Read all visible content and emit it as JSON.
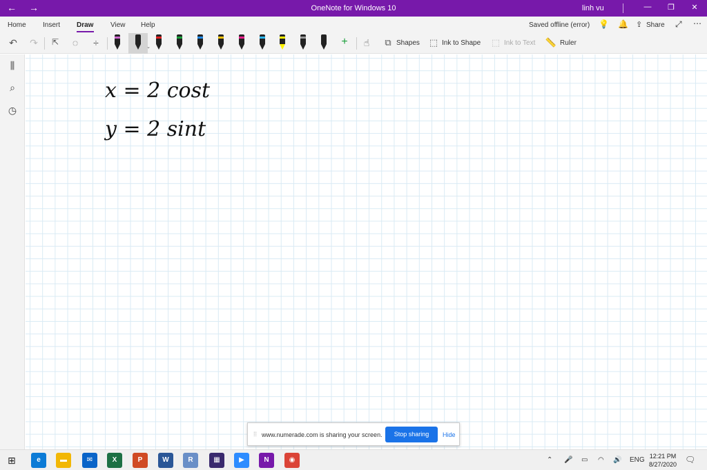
{
  "titlebar": {
    "back_icon": "back-arrow-icon",
    "forward_icon": "forward-arrow-icon",
    "title": "OneNote for Windows 10",
    "user": "linh vu",
    "minimize": "—",
    "restore": "❐",
    "close": "✕"
  },
  "menubar": {
    "tabs": [
      {
        "label": "Home"
      },
      {
        "label": "Insert"
      },
      {
        "label": "Draw",
        "active": true
      },
      {
        "label": "View"
      },
      {
        "label": "Help"
      }
    ],
    "status": "Saved offline (error)",
    "share": "Share"
  },
  "toolbar": {
    "shapes": "Shapes",
    "ink_to_shape": "Ink to Shape",
    "ink_to_text": "Ink to Text",
    "ruler": "Ruler",
    "pens": [
      {
        "color": "#222222",
        "band": "#cc66cc"
      },
      {
        "color": "#222222",
        "band": "#222222"
      },
      {
        "color": "#222222",
        "band": "#e02020"
      },
      {
        "color": "#222222",
        "band": "#1a9e3a"
      },
      {
        "color": "#222222",
        "band": "#1e88e5"
      },
      {
        "color": "#222222",
        "band": "#f4c20d"
      },
      {
        "color": "#222222",
        "band": "#e91e8c"
      },
      {
        "color": "#222222",
        "band": "#29b6f6"
      },
      {
        "color": "#222222",
        "band": "#fff200"
      },
      {
        "color": "#222222",
        "band": "#999999"
      },
      {
        "color": "#222222",
        "band": "#222222"
      }
    ]
  },
  "canvas": {
    "line1": "x = 2 cost",
    "line2": "y = 2 sint"
  },
  "share_bar": {
    "message": "www.numerade.com is sharing your screen.",
    "stop": "Stop sharing",
    "hide": "Hide"
  },
  "taskbar": {
    "language": "ENG",
    "time": "12:21 PM",
    "date": "8/27/2020",
    "apps": [
      {
        "name": "edge",
        "label": "e",
        "color": "#0c7bd6"
      },
      {
        "name": "file-explorer",
        "label": "▬",
        "color": "#f2b705"
      },
      {
        "name": "mail",
        "label": "✉",
        "color": "#0a64c8"
      },
      {
        "name": "excel",
        "label": "X",
        "color": "#1d7044"
      },
      {
        "name": "powerpoint",
        "label": "P",
        "color": "#d04a24"
      },
      {
        "name": "word",
        "label": "W",
        "color": "#2b5797"
      },
      {
        "name": "r-app",
        "label": "R",
        "color": "#6a8fc7"
      },
      {
        "name": "media-app",
        "label": "▦",
        "color": "#3a2a6e"
      },
      {
        "name": "zoom",
        "label": "▶",
        "color": "#2d8cff"
      },
      {
        "name": "onenote",
        "label": "N",
        "color": "#7719aa"
      },
      {
        "name": "chrome",
        "label": "◉",
        "color": "#db4437"
      }
    ]
  }
}
